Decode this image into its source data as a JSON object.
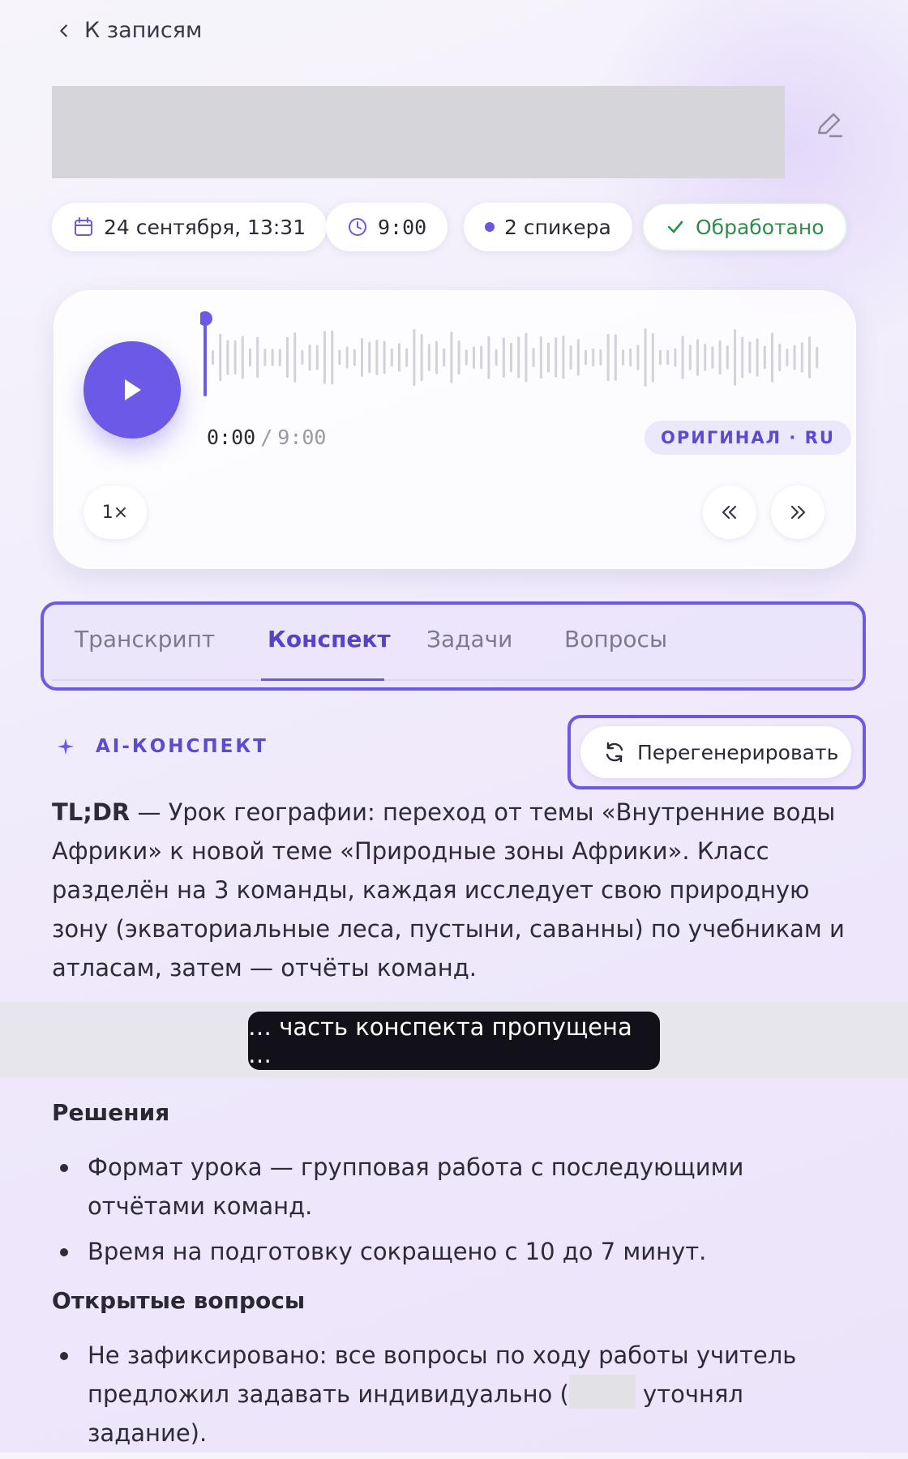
{
  "nav": {
    "back_label": "К записям"
  },
  "meta": {
    "date": "24 сентября, 13:31",
    "duration": "9:00",
    "speakers": "2 спикера",
    "status": "Обработано"
  },
  "player": {
    "current_time": "0:00",
    "separator": "/",
    "total_time": "9:00",
    "language_badge": "ОРИГИНАЛ · RU",
    "speed": "1×",
    "progress_fraction": 0
  },
  "tabs": [
    {
      "label": "Транскрипт"
    },
    {
      "label": "Конспект"
    },
    {
      "label": "Задачи"
    },
    {
      "label": "Вопросы"
    }
  ],
  "summary": {
    "ai_label": "AI-КОНСПЕКТ",
    "regenerate_label": "Перегенерировать",
    "tldr_label": "TL;DR",
    "tldr_text": " — Урок географии: переход от темы «Внутренние воды Африки» к новой теме «Природные зоны Африки». Класс разделён на 3 команды, каждая исследует свою природную зону (экваториальные леса, пустыни, саванны) по учебникам и атласам, затем — отчёты команд.",
    "gap_notice": "… часть конспекта пропущена …",
    "decisions_title": "Решения",
    "decisions": [
      "Формат урока — групповая работа с последующими отчётами команд.",
      "Время на подготовку сокращено с 10 до 7 минут."
    ],
    "open_questions_title": "Открытые вопросы",
    "open_question_before": "Не зафиксировано: все вопросы по ходу работы учитель предложил задавать индивидуально (",
    "open_question_after": " уточнял задание)."
  },
  "colors": {
    "accent": "#6c59e6",
    "status_ok": "#2e8c4d",
    "gap_pill": "#121119"
  }
}
